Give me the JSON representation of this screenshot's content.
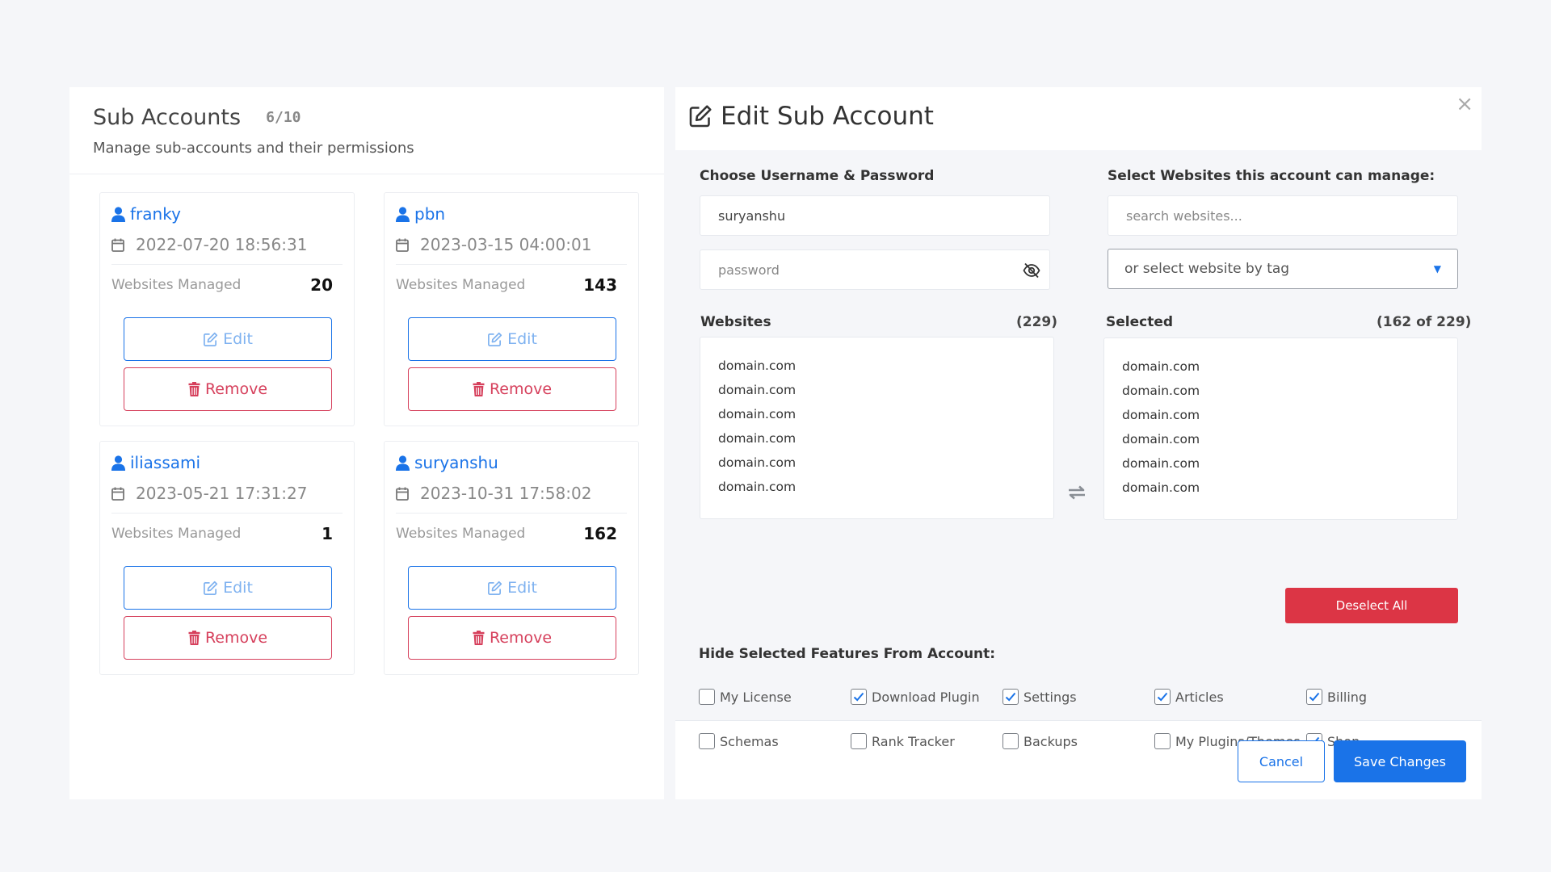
{
  "sub_accounts": {
    "title": "Sub Accounts",
    "count": "6/10",
    "subtitle": "Manage sub-accounts and their permissions",
    "websites_label": "Websites Managed",
    "edit_label": "Edit",
    "remove_label": "Remove",
    "cards": [
      {
        "username": "franky",
        "date": "2022-07-20 18:56:31",
        "websites": "20"
      },
      {
        "username": "pbn",
        "date": "2023-03-15 04:00:01",
        "websites": "143"
      },
      {
        "username": "iliassami",
        "date": "2023-05-21 17:31:27",
        "websites": "1"
      },
      {
        "username": "suryanshu",
        "date": "2023-10-31 17:58:02",
        "websites": "162"
      }
    ]
  },
  "modal": {
    "title": "Edit Sub Account",
    "close": "×",
    "credentials_label": "Choose Username & Password",
    "username_value": "suryanshu",
    "password_placeholder": "password",
    "select_label": "Select Websites this account can manage:",
    "search_placeholder": "search websites...",
    "tag_select": "or select website by tag",
    "websites": {
      "title": "Websites",
      "count": "(229)",
      "items": [
        "domain.com",
        "domain.com",
        "domain.com",
        "domain.com",
        "domain.com",
        "domain.com"
      ]
    },
    "selected": {
      "title": "Selected",
      "count": "(162 of 229)",
      "items": [
        "domain.com",
        "domain.com",
        "domain.com",
        "domain.com",
        "domain.com",
        "domain.com"
      ]
    },
    "deselect_all": "Deselect All",
    "features_label": "Hide Selected Features From Account:",
    "features": [
      {
        "label": "My License",
        "checked": false
      },
      {
        "label": "Download Plugin",
        "checked": true
      },
      {
        "label": "Settings",
        "checked": true
      },
      {
        "label": "Articles",
        "checked": true
      },
      {
        "label": "Billing",
        "checked": true
      },
      {
        "label": "Schemas",
        "checked": false
      },
      {
        "label": "Rank Tracker",
        "checked": false
      },
      {
        "label": "Backups",
        "checked": false
      },
      {
        "label": "My Plugins/Themes",
        "checked": false
      },
      {
        "label": "Shop",
        "checked": true
      }
    ],
    "cancel": "Cancel",
    "save": "Save Changes"
  },
  "colors": {
    "primary": "#1a73e8",
    "danger": "#dc3545",
    "background": "#f5f6f9"
  },
  "icons": {
    "user": "user-icon",
    "date": "calendar-icon",
    "edit": "edit-icon",
    "remove": "trash-icon",
    "password": "eye-off-icon",
    "swap": "swap-icon",
    "close": "close-icon"
  }
}
